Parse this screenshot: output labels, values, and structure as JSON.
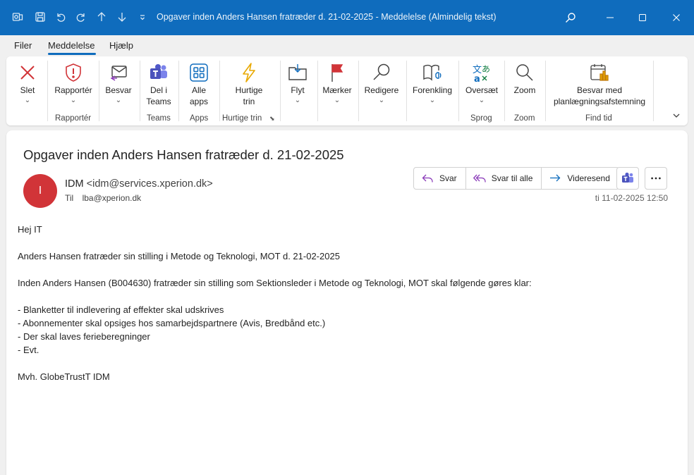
{
  "titlebar": {
    "title": "Opgaver inden Anders Hansen fratræder d. 21-02-2025  -  Meddelelse (Almindelig tekst)"
  },
  "menu": {
    "items": [
      "Filer",
      "Meddelelse",
      "Hjælp"
    ],
    "active": "Meddelelse"
  },
  "ribbon": {
    "buttons": {
      "delete": "Slet",
      "report": "Rapportér",
      "reply": "Besvar",
      "share_teams": "Del i Teams",
      "all_apps": "Alle apps",
      "quick_steps": "Hurtige trin",
      "move": "Flyt",
      "tags": "Mærker",
      "edit": "Redigere",
      "immersive": "Forenkling",
      "translate": "Oversæt",
      "zoom": "Zoom",
      "meeting_poll": "Besvar med planlægningsafstemning"
    },
    "groups": {
      "report": "Rapportér",
      "teams": "Teams",
      "apps": "Apps",
      "quick_steps": "Hurtige trin",
      "language": "Sprog",
      "zoom": "Zoom",
      "find_time": "Find tid"
    }
  },
  "message": {
    "subject": "Opgaver inden Anders Hansen fratræder d. 21-02-2025",
    "avatar_initial": "I",
    "sender_name": "IDM",
    "sender_email": "<idm@services.xperion.dk>",
    "to_label": "Til",
    "to_address": "lba@xperion.dk",
    "date": "ti 11-02-2025 12:50",
    "actions": {
      "reply": "Svar",
      "reply_all": "Svar til alle",
      "forward": "Videresend"
    },
    "body": [
      "Hej IT",
      "",
      "Anders Hansen fratræder sin stilling i Metode og Teknologi, MOT d. 21-02-2025",
      "",
      "Inden Anders Hansen (B004630) fratræder sin stilling som Sektionsleder i Metode og Teknologi, MOT skal følgende gøres klar:",
      "",
      "- Blanketter til indlevering af effekter skal udskrives",
      "- Abonnementer skal opsiges hos samarbejdspartnere (Avis, Bredbånd etc.)",
      "- Der skal laves ferieberegninger",
      "- Evt.",
      "",
      "Mvh. GlobeTrustT IDM"
    ]
  },
  "colors": {
    "titlebar": "#0f6cbd",
    "avatar": "#d13438",
    "accent": "#0f6cbd"
  }
}
